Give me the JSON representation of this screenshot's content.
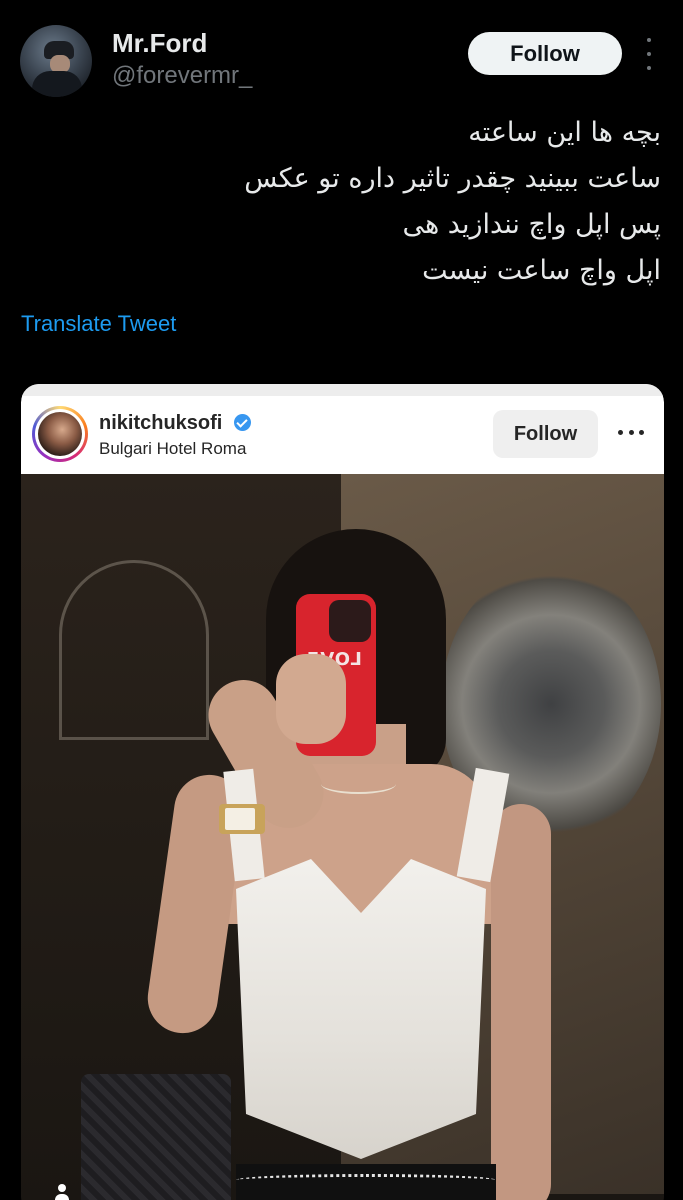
{
  "tweet": {
    "display_name": "Mr.Ford",
    "handle": "@forevermr_",
    "follow_label": "Follow",
    "text_lines": [
      "بچه ها این ساعته",
      "ساعت ببینید چقدر تاثیر داره تو عکس",
      "پس اپل واچ نندازید هی",
      "اپل واچ ساعت نیست"
    ],
    "translate_label": "Translate Tweet"
  },
  "embed": {
    "username": "nikitchuksofi",
    "location": "Bulgari Hotel Roma",
    "follow_label": "Follow",
    "phone_case_text": "LOVE"
  },
  "icons": {
    "more": "more-vertical-icon",
    "ig_more": "more-horizontal-icon",
    "verified": "verified-badge-icon",
    "tagged_user": "user-tag-icon"
  },
  "colors": {
    "background": "#000000",
    "link": "#1d9bf0",
    "verified": "#3897f0",
    "follow_button": "#eff3f4"
  }
}
